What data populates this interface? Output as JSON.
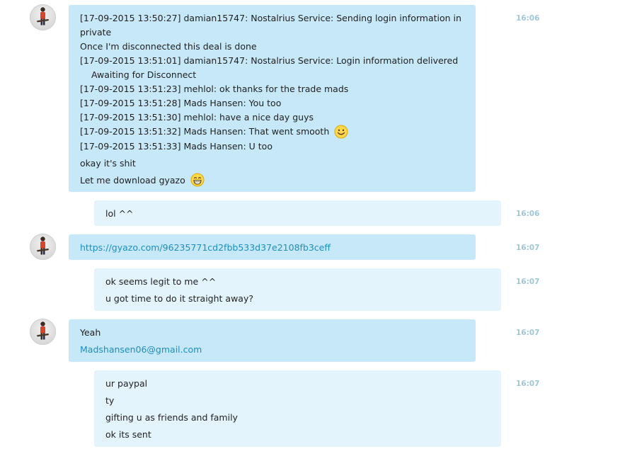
{
  "messages": [
    {
      "sender": "Mads Hansen",
      "lines": [
        "[17-09-2015 13:50:27] damian15747: Nostalrius Service: Sending login information in private",
        "Once I'm disconnected this deal is done",
        "[17-09-2015 13:51:01] damian15747: Nostalrius Service: Login information delivered",
        "Awaiting for Disconnect",
        "[17-09-2015 13:51:23] mehlol: ok thanks for the trade mads",
        "[17-09-2015 13:51:28] Mads Hansen: You too",
        "[17-09-2015 13:51:30] mehlol: have a nice day guys",
        "[17-09-2015 13:51:32] Mads Hansen: That went smooth",
        "[17-09-2015 13:51:33] Mads Hansen: U too",
        "okay it's shit",
        "Let me download gyazo"
      ],
      "time": "16:06"
    },
    {
      "sender": "me",
      "lines": [
        "lol ^^"
      ],
      "time": "16:06"
    },
    {
      "sender": "Mads Hansen",
      "lines": [
        "https://gyazo.com/96235771cd2fbb533d37e2108fb3ceff"
      ],
      "time": "16:07"
    },
    {
      "sender": "me",
      "lines": [
        "ok seems legit to me ^^",
        "u got time to do it straight away?"
      ],
      "time": "16:07"
    },
    {
      "sender": "Mads Hansen",
      "lines": [
        "Yeah",
        "Madshansen06@gmail.com"
      ],
      "time": "16:07"
    },
    {
      "sender": "me",
      "lines": [
        "ur paypal",
        "ty",
        "gifting u as friends and family",
        "ok its sent"
      ],
      "time": "16:07"
    }
  ],
  "emoji": [
    "smile-emoji",
    "grin-emoji"
  ],
  "colors": {
    "incoming_bubble": "#c6e8f8",
    "outgoing_bubble": "#e4f4fc",
    "timestamp": "#9fc7db",
    "link": "#1a8fc4"
  }
}
